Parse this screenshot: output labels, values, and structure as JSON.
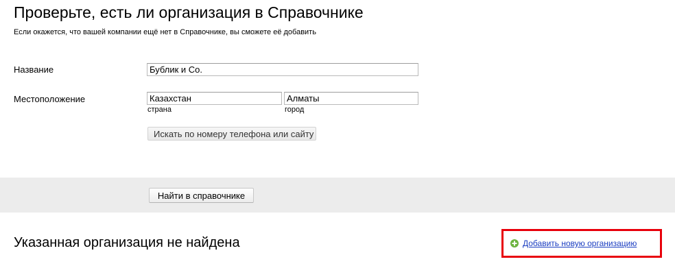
{
  "header": {
    "title": "Проверьте, есть ли организация в Справочнике",
    "subtitle": "Если окажется, что вашей компании ещё нет в Справочнике, вы сможете её добавить"
  },
  "form": {
    "name": {
      "label": "Название",
      "value": "Бублик и Со."
    },
    "location": {
      "label": "Местоположение",
      "country": {
        "value": "Казахстан",
        "hint": "страна"
      },
      "city": {
        "value": "Алматы",
        "hint": "город"
      }
    },
    "search_by_phone_label": "Искать по номеру телефона или сайту"
  },
  "search": {
    "button_label": "Найти в справочнике"
  },
  "result": {
    "title": "Указанная организация не найдена",
    "add_link_label": "Добавить новую организацию",
    "add_link_icon": "plus-circle-icon",
    "highlight_color": "#e8000b",
    "link_color": "#1a3dc1",
    "icon_color": "#6cb33f"
  }
}
